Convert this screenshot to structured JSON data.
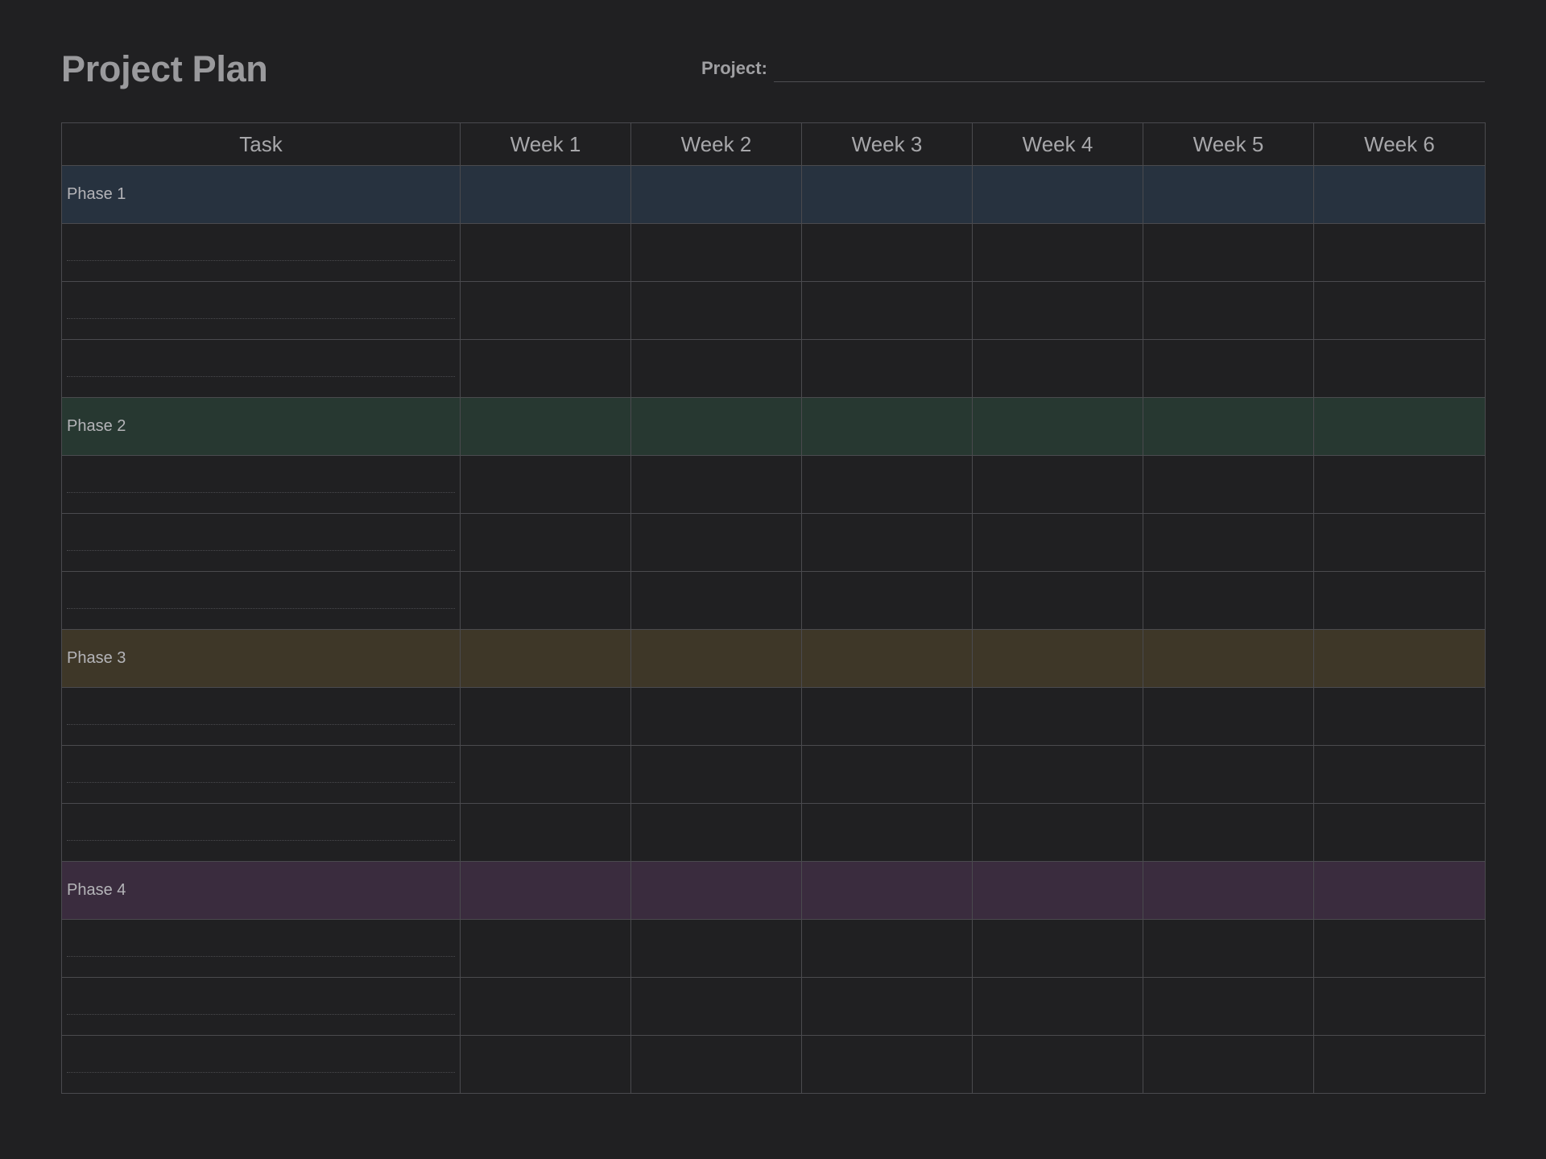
{
  "header": {
    "title": "Project Plan",
    "project_label": "Project:",
    "project_value": ""
  },
  "table": {
    "columns": [
      "Task",
      "Week 1",
      "Week 2",
      "Week 3",
      "Week 4",
      "Week 5",
      "Week 6"
    ],
    "phases": [
      {
        "label": "Phase 1",
        "color": "#27323f",
        "tasks": 3
      },
      {
        "label": "Phase 2",
        "color": "#273831",
        "tasks": 3
      },
      {
        "label": "Phase 3",
        "color": "#3e3728",
        "tasks": 3
      },
      {
        "label": "Phase 4",
        "color": "#3a2c3e",
        "tasks": 3
      }
    ]
  },
  "colors": {
    "background": "#202022",
    "grid_line": "#4a4a4e",
    "text": "#a3a3a6"
  }
}
